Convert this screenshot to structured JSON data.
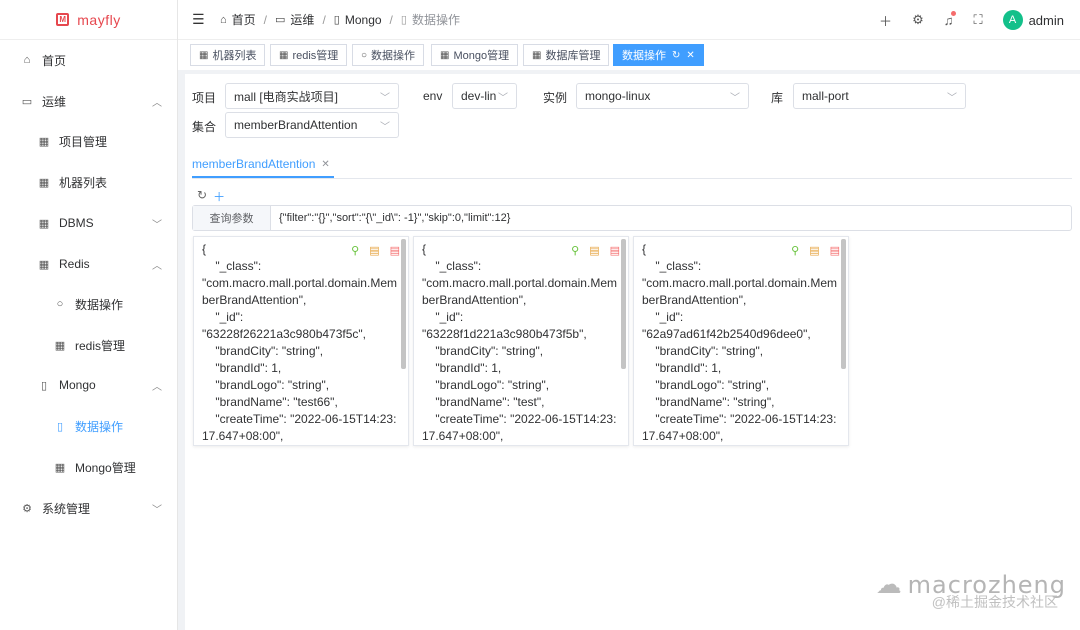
{
  "app": {
    "name": "mayfly"
  },
  "sidebar": {
    "items": [
      {
        "label": "首页",
        "icon": "home-icon",
        "glyph": "⌂",
        "chevron": ""
      },
      {
        "label": "运维",
        "icon": "monitor-icon",
        "glyph": "▭",
        "chevron": "︿"
      },
      {
        "label": "项目管理",
        "icon": "grid-icon",
        "glyph": "▦",
        "chevron": ""
      },
      {
        "label": "机器列表",
        "icon": "grid-icon",
        "glyph": "▦",
        "chevron": ""
      },
      {
        "label": "DBMS",
        "icon": "grid-icon",
        "glyph": "▦",
        "chevron": "﹀"
      },
      {
        "label": "Redis",
        "icon": "grid-icon",
        "glyph": "▦",
        "chevron": "︿"
      },
      {
        "label": "数据操作",
        "icon": "search-icon",
        "glyph": "○",
        "chevron": ""
      },
      {
        "label": "redis管理",
        "icon": "grid-icon",
        "glyph": "▦",
        "chevron": ""
      },
      {
        "label": "Mongo",
        "icon": "document-icon",
        "glyph": "▯",
        "chevron": "︿"
      },
      {
        "label": "数据操作",
        "icon": "document-icon",
        "glyph": "▯",
        "chevron": ""
      },
      {
        "label": "Mongo管理",
        "icon": "grid-icon",
        "glyph": "▦",
        "chevron": ""
      },
      {
        "label": "系统管理",
        "icon": "gear-icon",
        "glyph": "⚙",
        "chevron": "﹀"
      }
    ]
  },
  "header": {
    "breadcrumb": [
      "首页",
      "运维",
      "Mongo",
      "数据操作"
    ],
    "user": "admin",
    "avatar_letter": "A"
  },
  "tabs": [
    {
      "label": "机器列表",
      "icon": "grid-icon"
    },
    {
      "label": "redis管理",
      "icon": "grid-icon"
    },
    {
      "label": "数据操作",
      "icon": "search-icon"
    },
    {
      "label": "Mongo管理",
      "icon": "grid-icon"
    },
    {
      "label": "数据库管理",
      "icon": "grid-icon"
    },
    {
      "label": "数据操作",
      "icon": "",
      "active": true
    }
  ],
  "filters": {
    "project": {
      "label": "项目",
      "value": "mall [电商实战项目]"
    },
    "env": {
      "label": "env",
      "value": "dev-lin"
    },
    "instance": {
      "label": "实例",
      "value": "mongo-linux"
    },
    "db": {
      "label": "库",
      "value": "mall-port"
    },
    "collection": {
      "label": "集合",
      "value": "memberBrandAttention"
    }
  },
  "collection_tab": "memberBrandAttention",
  "query": {
    "label": "查询参数",
    "value": "{\"filter\":\"{}\",\"sort\":\"{\\\"_id\\\": -1}\",\"skip\":0,\"limit\":12}"
  },
  "documents": [
    "{\n    \"_class\":\n\"com.macro.mall.portal.domain.MemberBrandAttention\",\n    \"_id\":\n\"63228f26221a3c980b473f5c\",\n    \"brandCity\": \"string\",\n    \"brandId\": 1,\n    \"brandLogo\": \"string\",\n    \"brandName\": \"test66\",\n    \"createTime\": \"2022-06-15T14:23:17.647+08:00\",",
    "{\n    \"_class\":\n\"com.macro.mall.portal.domain.MemberBrandAttention\",\n    \"_id\":\n\"63228f1d221a3c980b473f5b\",\n    \"brandCity\": \"string\",\n    \"brandId\": 1,\n    \"brandLogo\": \"string\",\n    \"brandName\": \"test\",\n    \"createTime\": \"2022-06-15T14:23:17.647+08:00\",",
    "{\n    \"_class\":\n\"com.macro.mall.portal.domain.MemberBrandAttention\",\n    \"_id\":\n\"62a97ad61f42b2540d96dee0\",\n    \"brandCity\": \"string\",\n    \"brandId\": 1,\n    \"brandLogo\": \"string\",\n    \"brandName\": \"string\",\n    \"createTime\": \"2022-06-15T14:23:17.647+08:00\","
  ],
  "watermark": {
    "name": "macrozheng",
    "site": "@稀土掘金技术社区"
  },
  "colors": {
    "primary": "#409eff",
    "brand": "#e6474e"
  }
}
